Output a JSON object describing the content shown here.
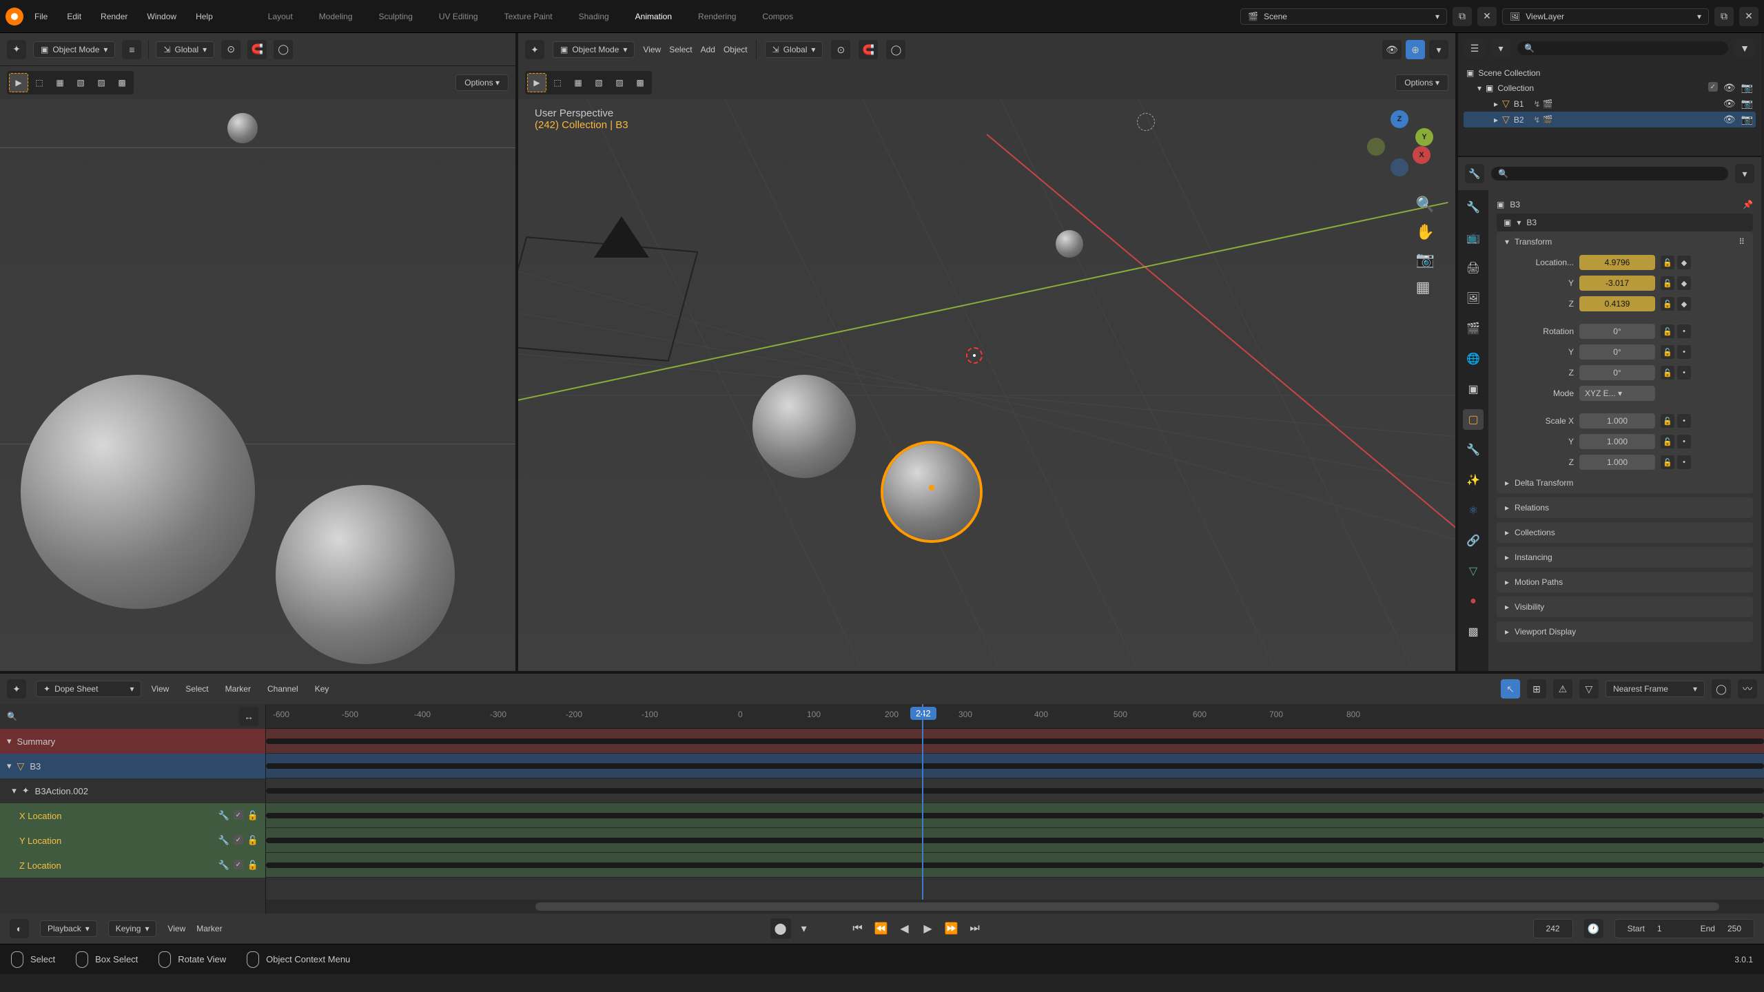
{
  "menus": {
    "file": "File",
    "edit": "Edit",
    "render": "Render",
    "window": "Window",
    "help": "Help"
  },
  "workspaces": {
    "layout": "Layout",
    "modeling": "Modeling",
    "sculpting": "Sculpting",
    "uv": "UV Editing",
    "texture": "Texture Paint",
    "shading": "Shading",
    "animation": "Animation",
    "rendering": "Rendering",
    "compositing": "Compos"
  },
  "header": {
    "scene": "Scene",
    "viewlayer": "ViewLayer"
  },
  "viewport": {
    "mode": "Object Mode",
    "orient": "Global",
    "options": "Options",
    "menu_view": "View",
    "menu_select": "Select",
    "menu_add": "Add",
    "menu_object": "Object",
    "persp": "User Perspective",
    "context": "(242) Collection | B3"
  },
  "gizmo": {
    "x": "X",
    "y": "Y",
    "z": "Z"
  },
  "outliner": {
    "scene": "Scene Collection",
    "collection": "Collection",
    "b1": "B1",
    "b2": "B2"
  },
  "properties": {
    "object": "B3",
    "transform": "Transform",
    "loc_label": "Location...",
    "loc_x": "4.9796",
    "loc_y": "-3.017",
    "loc_z": "0.4139",
    "y": "Y",
    "z": "Z",
    "rot_label": "Rotation",
    "rot_x": "0°",
    "rot_y": "0°",
    "rot_z": "0°",
    "mode_label": "Mode",
    "mode_val": "XYZ E...",
    "scale_label": "Scale X",
    "scale_x": "1.000",
    "scale_y": "1.000",
    "scale_z": "1.000",
    "delta": "Delta Transform",
    "relations": "Relations",
    "collections": "Collections",
    "instancing": "Instancing",
    "motion": "Motion Paths",
    "visibility": "Visibility",
    "vpdisplay": "Viewport Display"
  },
  "dope": {
    "editor": "Dope Sheet",
    "view": "View",
    "select": "Select",
    "marker": "Marker",
    "channel": "Channel",
    "key": "Key",
    "snap": "Nearest Frame",
    "summary": "Summary",
    "obj": "B3",
    "action": "B3Action.002",
    "xloc": "X Location",
    "yloc": "Y Location",
    "zloc": "Z Location",
    "ruler": {
      "m600": "-600",
      "m500": "-500",
      "m400": "-400",
      "m300": "-300",
      "m200": "-200",
      "m100": "-100",
      "z": "0",
      "p100": "100",
      "p200": "200",
      "cur": "242",
      "p300": "300",
      "p400": "400",
      "p500": "500",
      "p600": "600",
      "p700": "700",
      "p800": "800"
    }
  },
  "timeline": {
    "playback": "Playback",
    "keying": "Keying",
    "view": "View",
    "marker": "Marker",
    "frame": "242",
    "start_l": "Start",
    "start": "1",
    "end_l": "End",
    "end": "250"
  },
  "status": {
    "select": "Select",
    "box": "Box Select",
    "rotate": "Rotate View",
    "ctx": "Object Context Menu",
    "version": "3.0.1"
  }
}
